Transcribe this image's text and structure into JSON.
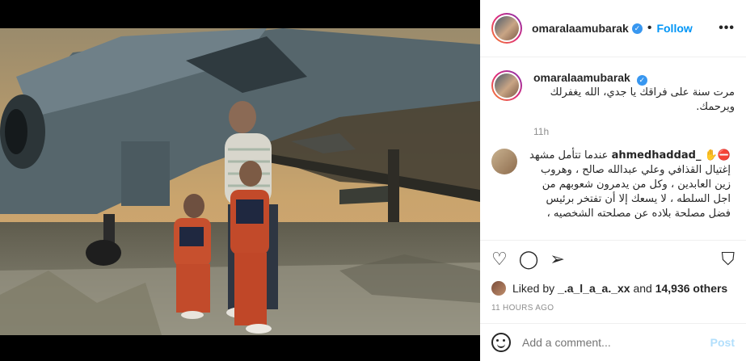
{
  "header": {
    "username": "omaralaamubarak",
    "follow_label": "Follow",
    "more": "•••"
  },
  "caption": {
    "username": "omaralaamubarak",
    "text": "مرت سنة على فراقك يا جدي، الله يغفرلك ويرحمك.",
    "time": "11h"
  },
  "comment": {
    "username": "ahmedhaddad_",
    "emojis": "⛔✋",
    "text": "عندما تتأمل مشهد إغتيال القذافي وعلي عبدالله صالح ، وهروب زين العابدين ، وكل من يدمرون شعوبهم من اجل السلطه ، لا يسعك إلا أن تفتخر برئيس فضل مصلحة بلاده عن مصلحته الشخصيه ،"
  },
  "likes": {
    "prefix": "Liked by",
    "user": "_.a_l_a_a._xx",
    "middle": "and",
    "others": "14,936 others"
  },
  "posted_ago": "11 HOURS AGO",
  "add_comment": {
    "placeholder": "Add a comment...",
    "post_label": "Post"
  },
  "icons": {
    "verified": "verified-badge",
    "like": "heart-icon",
    "comment": "comment-icon",
    "share": "share-icon",
    "save": "bookmark-icon",
    "emoji": "emoji-icon"
  },
  "colors": {
    "accent": "#0095f6",
    "verified": "#3897f0",
    "post_disabled": "#b2dffc"
  }
}
